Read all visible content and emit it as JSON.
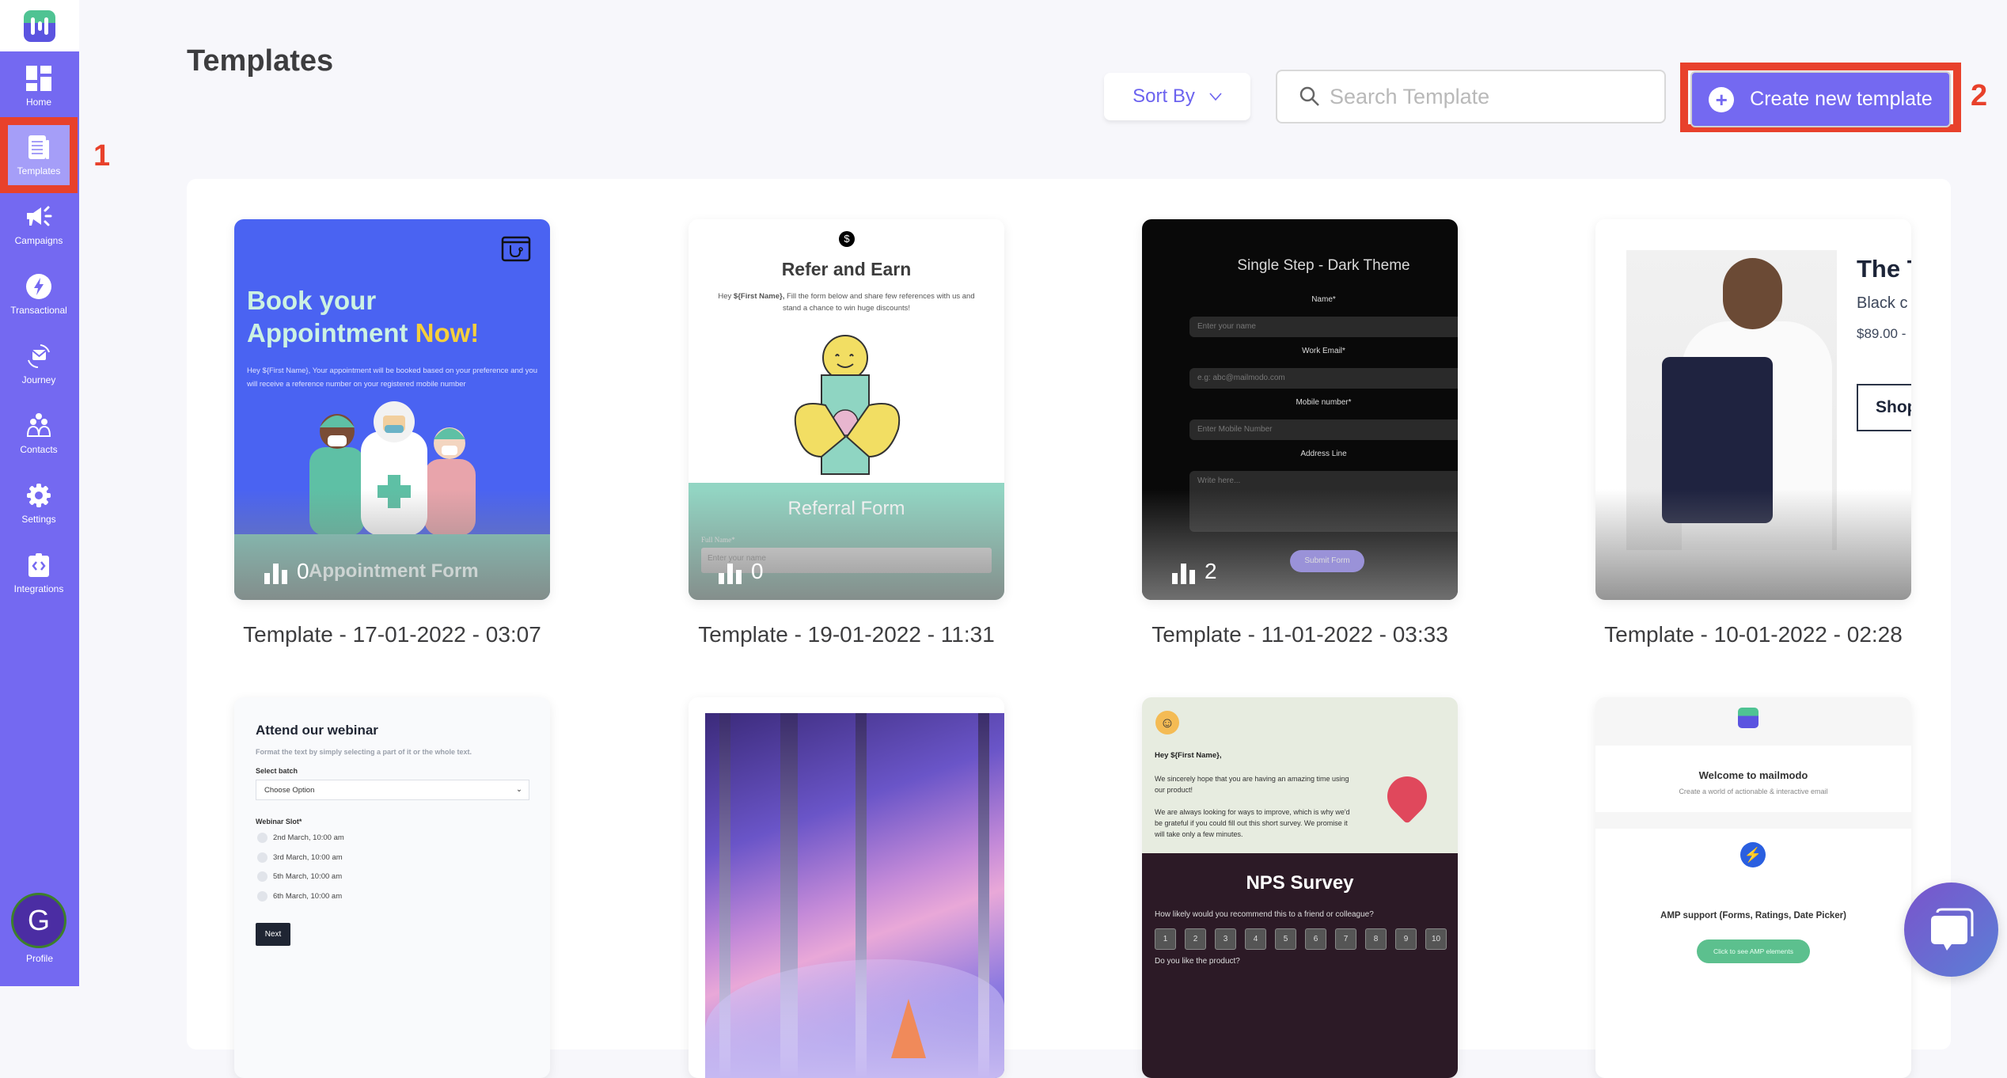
{
  "sidebar": {
    "logo": "mailmodo-logo",
    "items": [
      {
        "label": "Home",
        "icon": "dashboard-grid-icon",
        "active": false
      },
      {
        "label": "Templates",
        "icon": "document-icon",
        "active": true
      },
      {
        "label": "Campaigns",
        "icon": "megaphone-icon",
        "active": false
      },
      {
        "label": "Transactional",
        "icon": "lightning-icon",
        "active": false
      },
      {
        "label": "Journey",
        "icon": "envelope-cycle-icon",
        "active": false
      },
      {
        "label": "Contacts",
        "icon": "people-icon",
        "active": false
      },
      {
        "label": "Settings",
        "icon": "gear-icon",
        "active": false
      },
      {
        "label": "Integrations",
        "icon": "code-clipboard-icon",
        "active": false
      }
    ],
    "profile": {
      "initial": "G",
      "label": "Profile"
    }
  },
  "annotations": {
    "one": "1",
    "two": "2"
  },
  "header": {
    "title": "Templates",
    "sort_label": "Sort By",
    "sort_icon": "chevron-down-icon",
    "search_placeholder": "Search Template",
    "search_value": "",
    "create_label": "Create new template",
    "create_icon": "plus-circle-icon"
  },
  "colors": {
    "brand": "#7469f1",
    "annotation": "#e8412b",
    "active_nav": "#a59ef8"
  },
  "templates": [
    {
      "name": "Template - 17-01-2022 - 03:07",
      "stat": "0",
      "preview": {
        "title_line1": "Book your",
        "title_line2": "Appointment",
        "title_highlight": "Now!",
        "body": "Hey ${First Name}, Your appointment will be booked based on your preference and you will receive a reference number on your registered mobile number",
        "form_name": "Appointment Form"
      }
    },
    {
      "name": "Template - 19-01-2022 - 11:31",
      "stat": "0",
      "preview": {
        "title": "Refer and Earn",
        "body_bold": "${First Name},",
        "body_pre": "Hey",
        "body_post": "Fill the form below and share few references with us and stand a chance to win huge discounts!",
        "form_title": "Referral Form",
        "field_label": "Full Name*",
        "field_placeholder": "Enter your name"
      }
    },
    {
      "name": "Template - 11-01-2022 - 03:33",
      "stat": "2",
      "preview": {
        "title": "Single Step - Dark Theme",
        "fields": [
          {
            "label": "Name*",
            "placeholder": "Enter your name"
          },
          {
            "label": "Work Email*",
            "placeholder": "e.g: abc@mailmodo.com"
          },
          {
            "label": "Mobile number*",
            "placeholder": "Enter Mobile Number"
          },
          {
            "label": "Address Line",
            "placeholder": "Write here..."
          }
        ],
        "submit": "Submit Form"
      }
    },
    {
      "name": "Template - 10-01-2022 - 02:28",
      "preview": {
        "title": "The T",
        "subtitle": "Black c",
        "price": "$89.00 -",
        "button": "Shop"
      }
    },
    {
      "preview": {
        "title": "Attend our webinar",
        "subtitle": "Format the text by simply selecting a part of it or the whole text.",
        "select_label": "Select batch",
        "select_value": "Choose Option",
        "slot_label": "Webinar Slot*",
        "slots": [
          "2nd March, 10:00 am",
          "3rd March, 10:00 am",
          "5th March, 10:00 am",
          "6th March, 10:00 am"
        ],
        "next": "Next"
      }
    },
    {
      "preview": {
        "image": "snowy-forest-campfire-illustration"
      }
    },
    {
      "preview": {
        "greeting": "Hey ${First Name},",
        "para1": "We sincerely hope that you are having an amazing time using our product!",
        "para2": "We are always looking for ways to improve, which is why we'd be grateful if you could fill out this short survey. We promise it will take only a few minutes.",
        "title": "NPS Survey",
        "question": "How likely would you recommend this to a friend or colleague?",
        "scale": [
          "1",
          "2",
          "3",
          "4",
          "5",
          "6",
          "7",
          "8",
          "9",
          "10"
        ],
        "question2": "Do you like the product?"
      }
    },
    {
      "preview": {
        "welcome": "Welcome to mailmodo",
        "tagline": "Create a world of actionable & interactive email",
        "feature": "AMP support (Forms, Ratings, Date Picker)",
        "button": "Click to see AMP elements"
      }
    }
  ],
  "chat": {
    "icon": "chat-bubble-icon"
  }
}
